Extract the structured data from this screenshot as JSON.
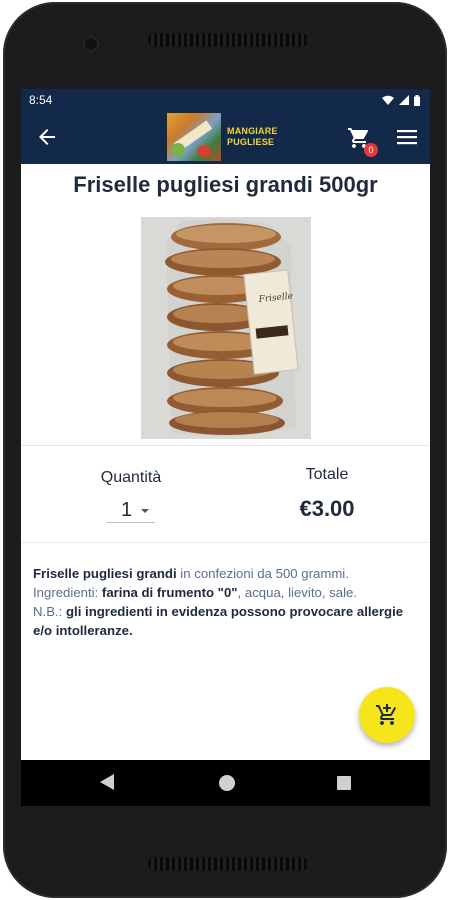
{
  "status": {
    "time": "8:54"
  },
  "appbar": {
    "logo_line1": "MANGIARE",
    "logo_line2": "PUGLIESE",
    "cart_count": "0"
  },
  "product": {
    "title": "Friselle pugliesi grandi 500gr",
    "quantity_label": "Quantità",
    "quantity_value": "1",
    "total_label": "Totale",
    "total_value": "€3.00",
    "label_on_package": "Friselle"
  },
  "description": {
    "line1_bold": "Friselle pugliesi grandi",
    "line1_rest": " in confezioni da 500 grammi.",
    "line2_start": "Ingredienti: ",
    "line2_bold": "farina di frumento \"0\"",
    "line2_rest": ", acqua, lievito, sale.",
    "line3_start": "N.B.: ",
    "line3_bold": "gli ingredienti in evidenza possono provocare allergie e/o intolleranze."
  },
  "icons": {
    "back": "arrow-back-icon",
    "cart": "cart-icon",
    "menu": "menu-icon",
    "fab": "add-to-cart-icon",
    "wifi": "wifi-icon",
    "signal": "signal-icon",
    "battery": "battery-icon"
  },
  "colors": {
    "primary": "#13294a",
    "accent": "#f7e51c",
    "badge": "#e53935",
    "logo_text": "#f5d33a"
  }
}
